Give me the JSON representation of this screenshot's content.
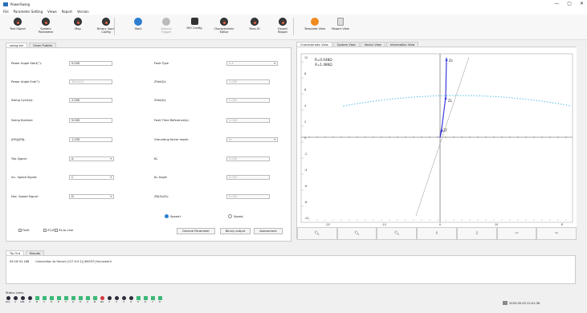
{
  "window": {
    "title": "PowerSwing",
    "minimize": "—",
    "maximize": "▢",
    "close": "✕"
  },
  "menu": [
    "File",
    "Parameter Setting",
    "Views",
    "Report",
    "Version"
  ],
  "toolbar": [
    {
      "label": "Test Object",
      "icon": "test-object-icon",
      "style": "dark"
    },
    {
      "label": "System\nParameter",
      "icon": "system-parameter-icon",
      "style": "dark"
    },
    {
      "label": "Map",
      "icon": "map-icon",
      "style": "dark"
    },
    {
      "label": "Binary input\nConfig",
      "icon": "binary-input-icon",
      "style": "dark"
    },
    {
      "label": "Start",
      "icon": "start-icon",
      "style": "blue"
    },
    {
      "label": "Manual\nTrigger",
      "icon": "manual-trigger-icon",
      "style": "grey",
      "disabled": true
    },
    {
      "label": "RIO Config",
      "icon": "gear-icon",
      "style": "gear"
    },
    {
      "label": "Characteristic\nEditor",
      "icon": "characteristic-editor-icon",
      "style": "dark"
    },
    {
      "label": "Rms-IO",
      "icon": "rms-io-icon",
      "style": "dark"
    },
    {
      "label": "Export\nReport",
      "icon": "export-report-icon",
      "style": "dark"
    },
    {
      "label": "Template View",
      "icon": "template-view-icon",
      "style": "orange"
    },
    {
      "label": "Report View",
      "icon": "report-view-icon",
      "style": "clip"
    }
  ],
  "left_tabs": [
    "swing set",
    "Given Publish"
  ],
  "left_fields": [
    {
      "label": "Power Angle Start(°):",
      "value": "0.000",
      "dim": false
    },
    {
      "label": "Power Angle End(°):",
      "value": "360.000",
      "dim": true
    },
    {
      "label": "Swing Cycle(s):",
      "value": "2.000",
      "dim": false
    },
    {
      "label": "Swing Number:",
      "value": "5.000",
      "dim": false
    },
    {
      "label": "|EM|/|EN|:",
      "value": "1.250",
      "dim": false
    },
    {
      "label": "Trip Signal:",
      "value": "A",
      "select": true
    },
    {
      "label": "Inc. Speed Signal:",
      "value": "C",
      "select": true
    },
    {
      "label": "Dec. Speed Signal:",
      "value": "D",
      "select": true
    }
  ],
  "right_fields": [
    {
      "label": "Fault Type",
      "value": "A-E",
      "select": true,
      "dim": true
    },
    {
      "label": "ZSet(Ω):",
      "value": "1.000",
      "dim": true
    },
    {
      "label": "ZSet(Ω):",
      "value": "0.000",
      "dim": true
    },
    {
      "label": "Fault Time Reference(s):",
      "value": "0.000",
      "dim": true
    },
    {
      "label": "Grounding factor mode:",
      "value": "KL",
      "select": true,
      "dim": true
    },
    {
      "label": "KL",
      "value": "0.000",
      "dim": true
    },
    {
      "label": "KL Angle",
      "value": "0.000",
      "dim": true
    },
    {
      "label": "ZN(Zs/Zl):",
      "value": "0.000",
      "dim": true
    }
  ],
  "radios": [
    {
      "label": "Speed+",
      "on": true
    },
    {
      "label": "Speed-",
      "on": false
    }
  ],
  "checks": [
    "Fault",
    "Z1/Z2",
    "Zs-to-Line"
  ],
  "buttons": {
    "general": "General Parameter",
    "binary": "Binary output",
    "assessment": "Assessment"
  },
  "right_tabs": [
    "Characteristic View",
    "System View",
    "Vector View",
    "Information View"
  ],
  "plot": {
    "info_line1": "R=0.048Ω",
    "info_line2": "X=1.486Ω",
    "labels": {
      "zs": "Zs",
      "zl": "ZL",
      "zf": "ZF"
    },
    "x_ticks": [
      "-20",
      "-10",
      "0",
      "10",
      "R"
    ],
    "y_ticks": [
      "12",
      "8",
      "6",
      "4",
      "2",
      "0",
      "-2",
      "-4",
      "-6",
      "-8",
      "-10"
    ]
  },
  "plot_buttons": [
    "zoom-in",
    "zoom-out",
    "zoom-fit",
    "pan-up",
    "pan-down",
    "pan-left",
    "pan-right"
  ],
  "bottom_tabs": [
    "Tip Out",
    "Results"
  ],
  "log": {
    "time": "09:16:31.166",
    "message": "Connection to Server [127.0.0.1] [60037] Successful"
  },
  "status_label": "Status Lamp",
  "leds": [
    {
      "label": "Run",
      "style": "dark"
    },
    {
      "label": "2",
      "style": "dark"
    },
    {
      "label": "DBr",
      "style": "dark"
    },
    {
      "label": "A",
      "style": "dark"
    },
    {
      "label": "B",
      "style": "green"
    },
    {
      "label": "C",
      "style": "green"
    },
    {
      "label": "D",
      "style": "green"
    },
    {
      "label": "E",
      "style": "green"
    },
    {
      "label": "F",
      "style": "green"
    },
    {
      "label": "G",
      "style": "green"
    },
    {
      "label": "H",
      "style": "green"
    },
    {
      "label": "A",
      "style": "green"
    },
    {
      "label": "B",
      "style": "green"
    },
    {
      "label": "Nd",
      "style": "red"
    },
    {
      "label": "1",
      "style": "dark"
    },
    {
      "label": "2",
      "style": "dark"
    },
    {
      "label": "3",
      "style": "dark"
    },
    {
      "label": "4",
      "style": "dark"
    },
    {
      "label": "5",
      "style": "green"
    },
    {
      "label": "6",
      "style": "green"
    },
    {
      "label": "7",
      "style": "green"
    },
    {
      "label": "8",
      "style": "green"
    }
  ],
  "clock": "2020-05-05 22:41:36"
}
